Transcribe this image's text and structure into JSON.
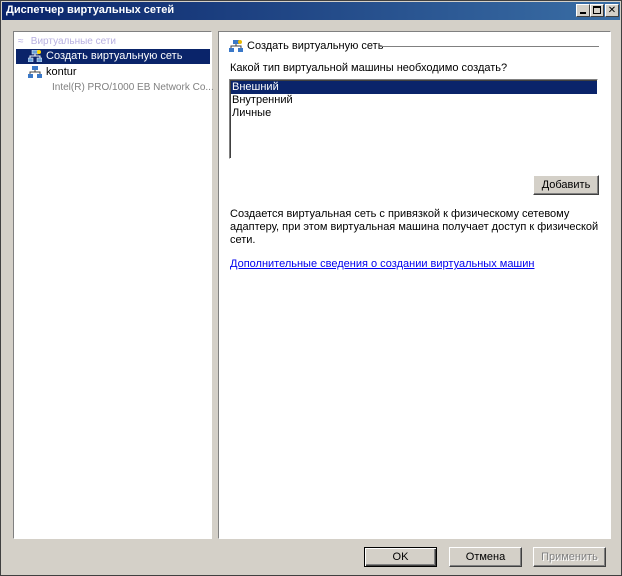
{
  "window": {
    "title": "Диспетчер виртуальных сетей"
  },
  "tree": {
    "header": "Виртуальные сети",
    "items": [
      {
        "label": "Создать виртуальную сеть",
        "selected": true
      },
      {
        "label": "kontur",
        "sublabel": "Intel(R) PRO/1000 EB Network Co..."
      }
    ]
  },
  "content": {
    "section_title": "Создать виртуальную сеть",
    "prompt": "Какой тип виртуальной машины необходимо создать?",
    "options": [
      "Внешний",
      "Внутренний",
      "Личные"
    ],
    "selected_option": "Внешний",
    "add_button": "Добавить",
    "description": "Создается виртуальная сеть с привязкой к физическому сетевому адаптеру, при этом виртуальная машина получает доступ к физической сети.",
    "link": "Дополнительные сведения о создании виртуальных машин"
  },
  "buttons": {
    "ok": "OK",
    "cancel": "Отмена",
    "apply": "Применить"
  },
  "colors": {
    "title_start": "#0a246a",
    "title_end": "#3a6ea5",
    "selection": "#0a246a",
    "link": "#0000ee"
  }
}
